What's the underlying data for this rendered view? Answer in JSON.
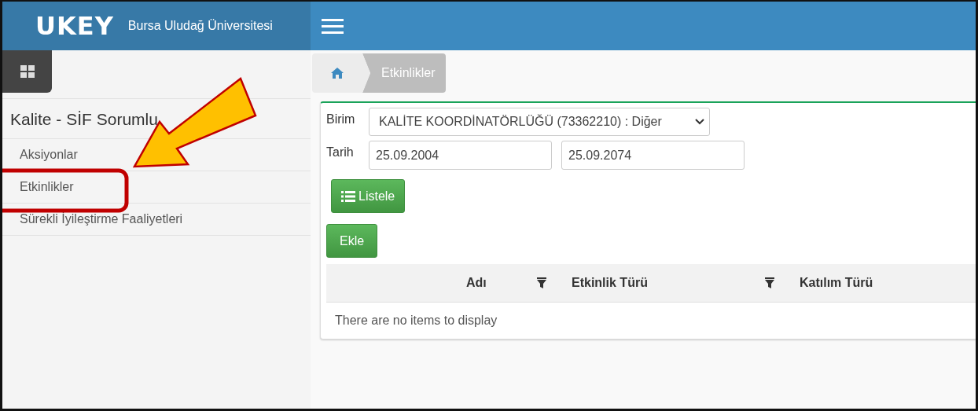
{
  "header": {
    "logo": "UKEY",
    "university": "Bursa Uludağ Üniversitesi"
  },
  "sidebar": {
    "title": "Kalite - SİF Sorumlu",
    "items": [
      {
        "label": "Aksiyonlar",
        "selected": false
      },
      {
        "label": "Etkinlikler",
        "selected": false
      },
      {
        "label": "Sürekli İyileştirme Faaliyetleri",
        "selected": false
      }
    ]
  },
  "breadcrumb": {
    "current": "Etkinlikler"
  },
  "form": {
    "birim_label": "Birim",
    "birim_value": "KALİTE KOORDİNATÖRLÜĞÜ (73362210) : Diğer",
    "tarih_label": "Tarih",
    "date_from": "25.09.2004",
    "date_to": "25.09.2074",
    "list_button": "Listele",
    "add_button": "Ekle"
  },
  "table": {
    "columns": [
      {
        "label": "Adı",
        "filter": true
      },
      {
        "label": "Etkinlik Türü",
        "filter": true
      },
      {
        "label": "Katılım Türü",
        "filter": false
      }
    ],
    "empty": "There are no items to display"
  },
  "annotations": {
    "arrow": true,
    "frame": true
  }
}
